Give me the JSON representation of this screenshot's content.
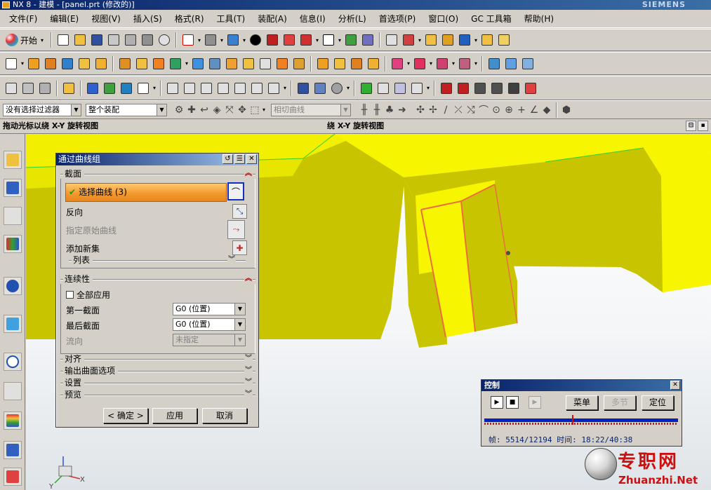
{
  "window": {
    "title": "NX 8 - 建模 - [panel.prt (修改的)]",
    "brand": "SIEMENS"
  },
  "menu": [
    "文件(F)",
    "编辑(E)",
    "视图(V)",
    "插入(S)",
    "格式(R)",
    "工具(T)",
    "装配(A)",
    "信息(I)",
    "分析(L)",
    "首选项(P)",
    "窗口(O)",
    "GC 工具箱",
    "帮助(H)"
  ],
  "toolbar": {
    "start_label": "开始"
  },
  "selection_bar": {
    "filter": "没有选择过滤器",
    "scope": "整个装配",
    "curve_rule": "相切曲线"
  },
  "status": {
    "left_prompt": "拖动光标以绕 X-Y 旋转视图",
    "right_prompt": "绕 X-Y 旋转视图"
  },
  "dialog": {
    "title": "通过曲线组",
    "section_label": "截面",
    "select_curve": "选择曲线 (3)",
    "reverse": "反向",
    "specify_origin_curve": "指定原始曲线",
    "add_new_set": "添加新集",
    "list_label": "列表",
    "continuity_label": "连续性",
    "apply_all": "全部应用",
    "first_section": "第一截面",
    "first_section_value": "G0 (位置)",
    "last_section": "最后截面",
    "last_section_value": "G0 (位置)",
    "flow_dir": "流向",
    "flow_dir_value": "未指定",
    "collapsed": [
      "对齐",
      "输出曲面选项",
      "设置",
      "预览"
    ],
    "ok": "< 确定 >",
    "apply": "应用",
    "cancel": "取消"
  },
  "control": {
    "title": "控制",
    "menu_btn": "菜单",
    "multi_btn": "多节",
    "locate_btn": "定位",
    "frame_label": "帧:",
    "frame_value": "5514/12194",
    "time_label": "时间:",
    "time_value": "18:22/40:38",
    "progress": 0.452
  },
  "watermark": {
    "cn": "专职网",
    "en": "Zhuanzhi.Net"
  },
  "axes": {
    "x": "X",
    "y": "Y"
  },
  "colors": {
    "model_face": "#c9c400",
    "model_edge": "#ffff00",
    "highlight": "#f29a2e",
    "title_blue": "#0a246a"
  }
}
